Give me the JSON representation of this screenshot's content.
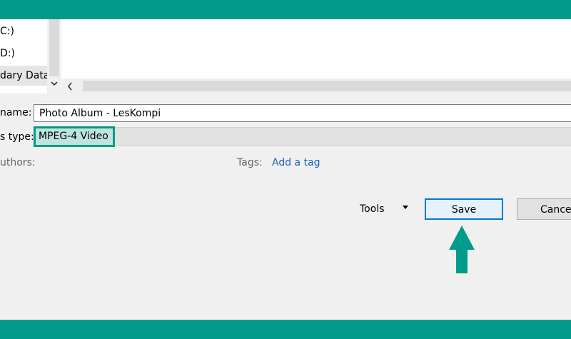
{
  "nav_tree": {
    "items": [
      {
        "label": "C:)"
      },
      {
        "label": "D:)"
      },
      {
        "label": "dary Data",
        "selected": true
      }
    ]
  },
  "file_name": {
    "label": "name:",
    "value": "Photo Album - LesKompi"
  },
  "save_as_type": {
    "label": "s type:",
    "value": "MPEG-4 Video"
  },
  "metadata": {
    "authors_label": "uthors:",
    "tags_label": "Tags:",
    "tags_link": "Add a tag"
  },
  "footer": {
    "tools_label": "Tools",
    "save_label": "Save",
    "cancel_label": "Cancel"
  },
  "colors": {
    "accent_band": "#009b8a",
    "highlight_border": "#009b8a",
    "link": "#1a64b8",
    "save_border": "#0078d7"
  },
  "icons": [
    "chevron-down-icon",
    "chevron-left-icon",
    "caret-down-icon",
    "arrow-up-icon"
  ]
}
